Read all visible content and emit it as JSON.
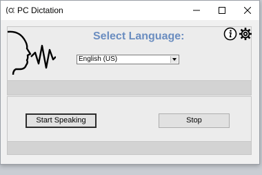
{
  "window": {
    "title": "PC Dictation"
  },
  "header": {
    "heading": "Select Language:"
  },
  "language": {
    "selected": "English (US)"
  },
  "buttons": {
    "start": "Start Speaking",
    "stop": "Stop"
  },
  "icons": {
    "app": "app-icon",
    "info": "info-icon",
    "settings": "gear-icon",
    "waveform": "voice-waveform-icon",
    "minimize": "minimize-icon",
    "maximize": "maximize-icon",
    "close": "close-icon"
  },
  "colors": {
    "heading": "#6a8dc0"
  }
}
